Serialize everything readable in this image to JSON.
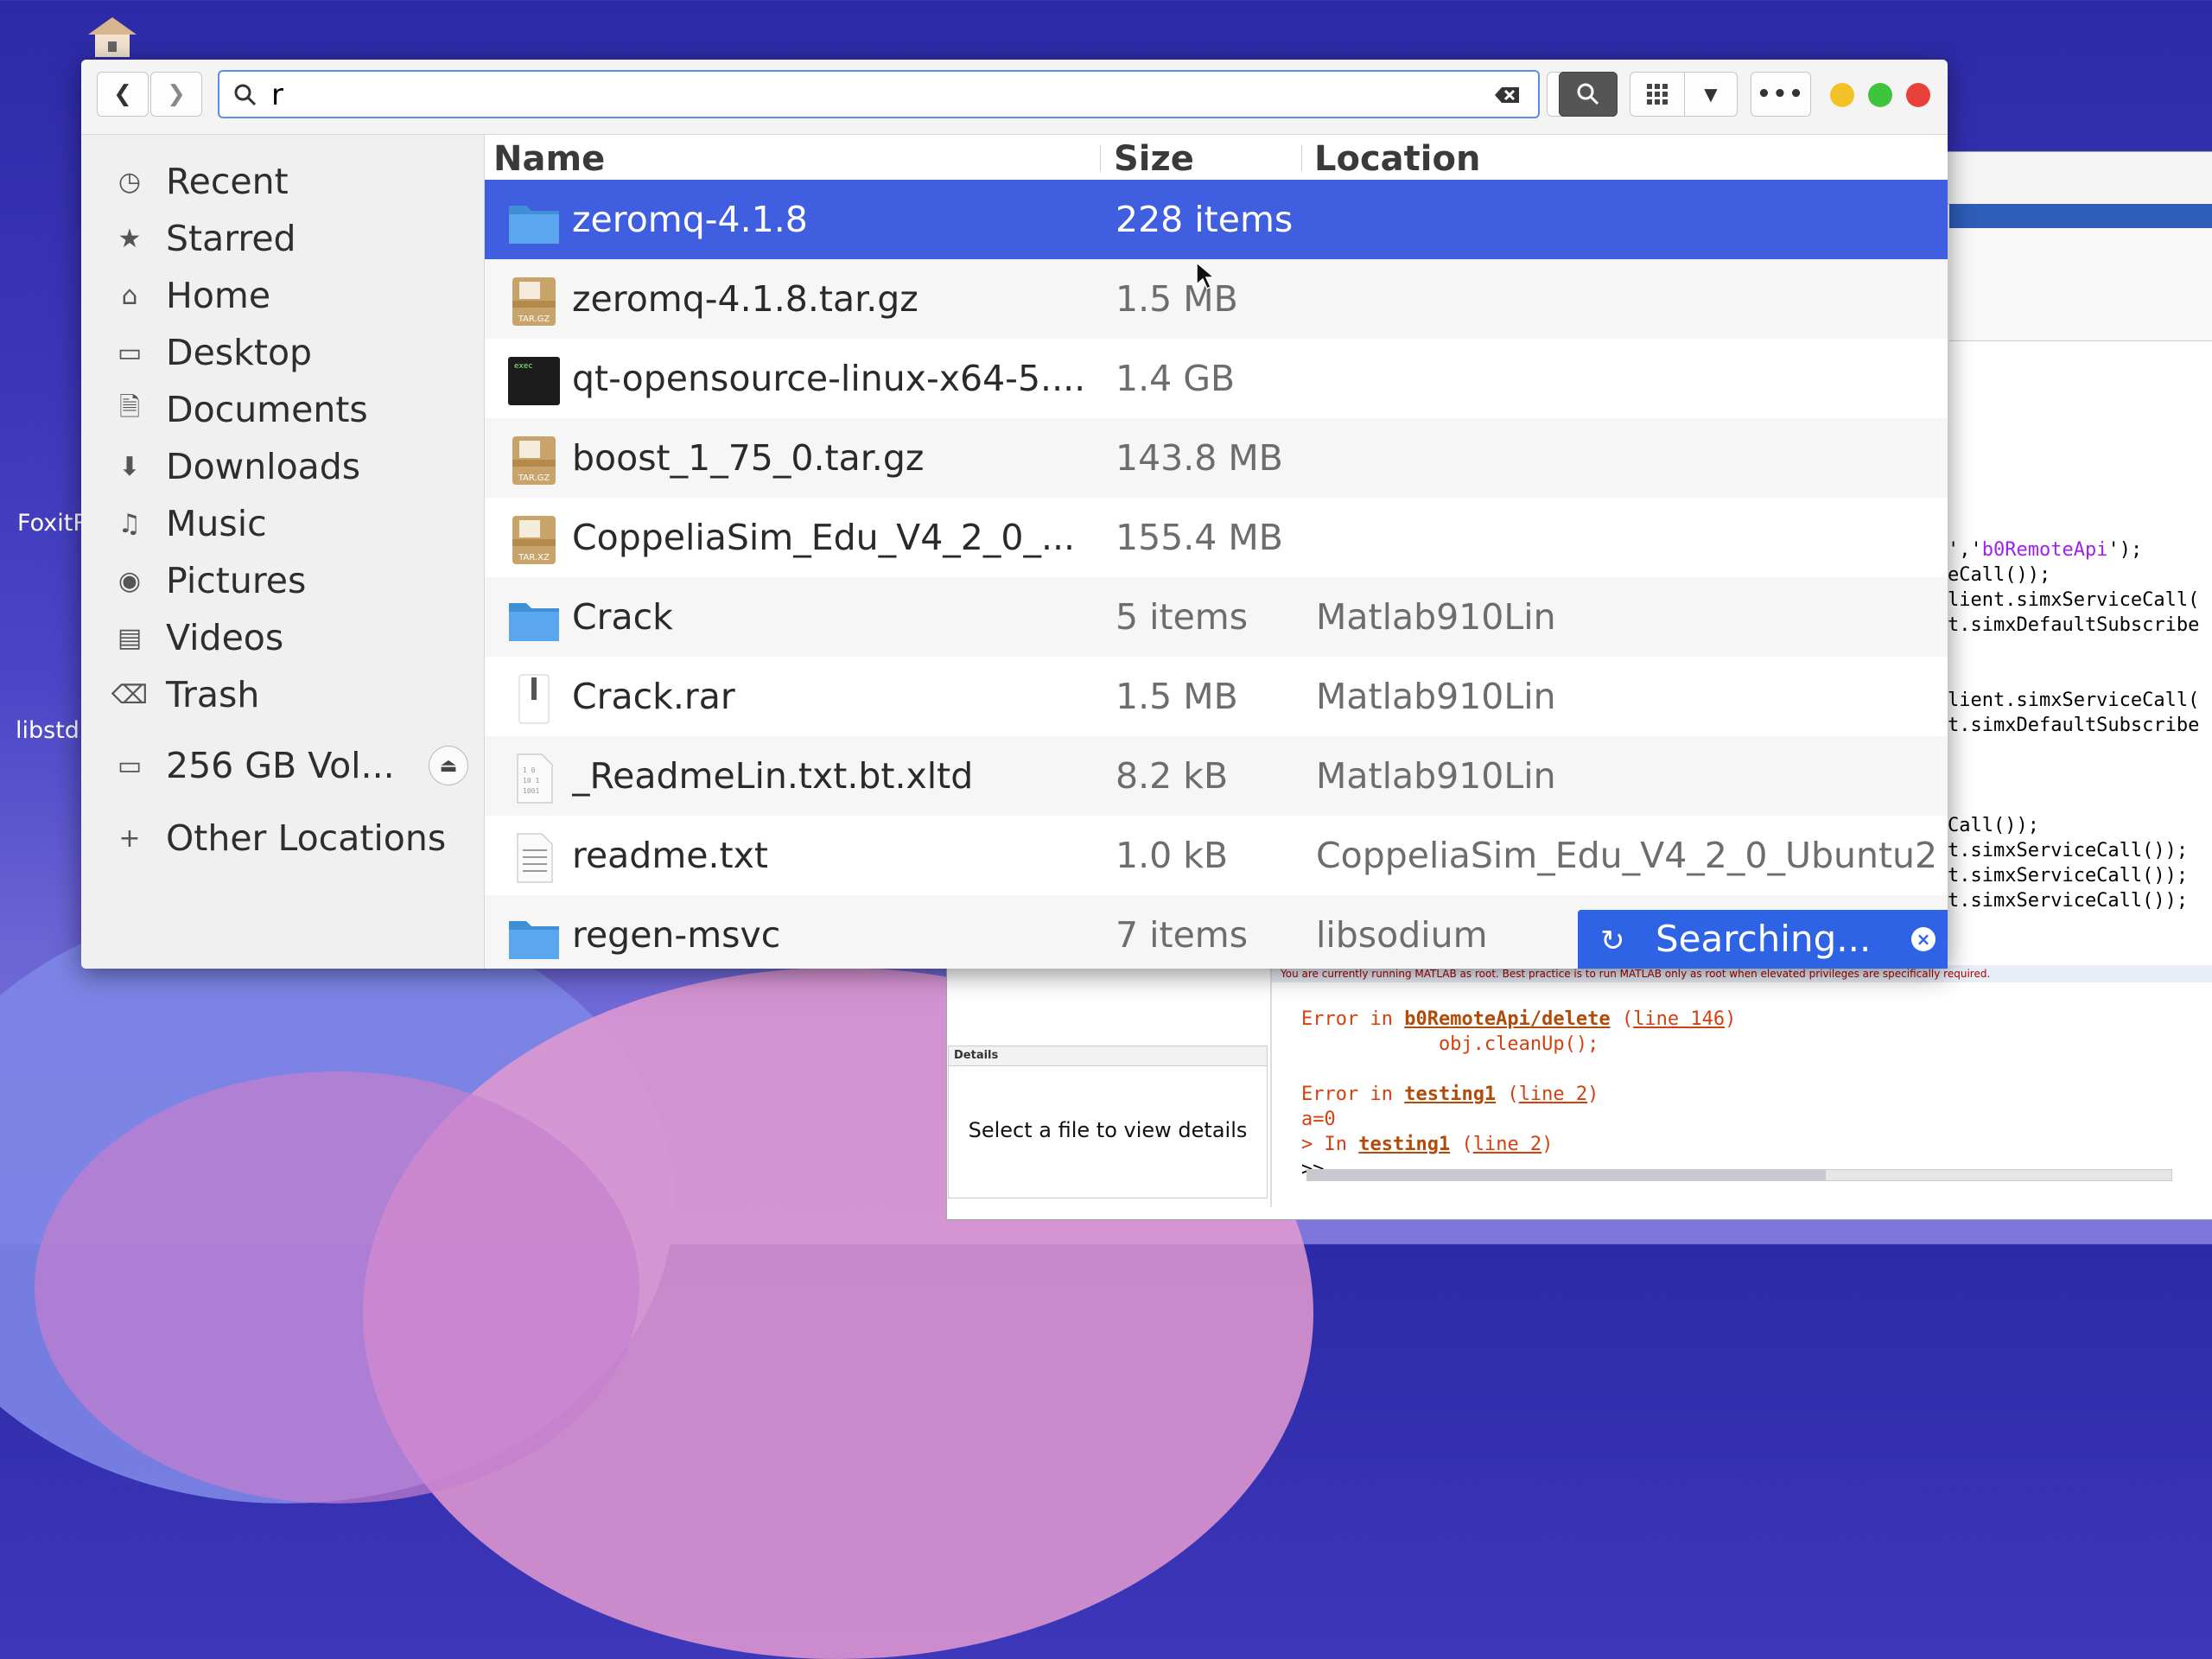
{
  "desktop": {
    "icons": [
      {
        "label": "FoxitR..."
      },
      {
        "label": "libstd..."
      }
    ]
  },
  "toolbar": {
    "search_value": "r",
    "search_placeholder": ""
  },
  "sidebar": {
    "items": [
      {
        "label": "Recent",
        "icon": "clock-icon"
      },
      {
        "label": "Starred",
        "icon": "star-icon"
      },
      {
        "label": "Home",
        "icon": "home-icon"
      },
      {
        "label": "Desktop",
        "icon": "desktop-icon"
      },
      {
        "label": "Documents",
        "icon": "documents-icon"
      },
      {
        "label": "Downloads",
        "icon": "download-icon"
      },
      {
        "label": "Music",
        "icon": "music-icon"
      },
      {
        "label": "Pictures",
        "icon": "camera-icon"
      },
      {
        "label": "Videos",
        "icon": "film-icon"
      },
      {
        "label": "Trash",
        "icon": "trash-icon"
      },
      {
        "label": "256 GB Vol...",
        "icon": "drive-icon"
      },
      {
        "label": "Other Locations",
        "icon": "plus-icon"
      }
    ]
  },
  "list": {
    "headers": {
      "name": "Name",
      "size": "Size",
      "location": "Location"
    },
    "rows": [
      {
        "name": "zeromq-4.1.8",
        "size": "228 items",
        "location": "",
        "type": "folder"
      },
      {
        "name": "zeromq-4.1.8.tar.gz",
        "size": "1.5 MB",
        "location": "",
        "type": "archive-targz",
        "badge": "TAR.GZ"
      },
      {
        "name": "qt-opensource-linux-x64-5....",
        "size": "1.4 GB",
        "location": "",
        "type": "executable",
        "badge": "exec"
      },
      {
        "name": "boost_1_75_0.tar.gz",
        "size": "143.8 MB",
        "location": "",
        "type": "archive-targz",
        "badge": "TAR.GZ"
      },
      {
        "name": "CoppeliaSim_Edu_V4_2_0_...",
        "size": "155.4 MB",
        "location": "",
        "type": "archive-tarxz",
        "badge": "TAR.XZ"
      },
      {
        "name": "Crack",
        "size": "5 items",
        "location": "Matlab910Lin",
        "type": "folder"
      },
      {
        "name": "Crack.rar",
        "size": "1.5 MB",
        "location": "Matlab910Lin",
        "type": "archive-rar"
      },
      {
        "name": "_ReadmeLin.txt.bt.xltd",
        "size": "8.2 kB",
        "location": "Matlab910Lin",
        "type": "binary"
      },
      {
        "name": "readme.txt",
        "size": "1.0 kB",
        "location": "CoppeliaSim_Edu_V4_2_0_Ubuntu2",
        "type": "text"
      },
      {
        "name": "regen-msvc",
        "size": "7 items",
        "location": "libsodium",
        "type": "folder"
      }
    ]
  },
  "toast": {
    "label": "Searching..."
  },
  "matlab": {
    "code": [
      {
        "pre": "','",
        "str": "b0RemoteApi",
        "post": "');"
      },
      {
        "pre": "eCall());",
        "str": "",
        "post": ""
      },
      {
        "pre": "lient.simxServiceCall(",
        "str": "",
        "post": ""
      },
      {
        "pre": "t.simxDefaultSubscribe",
        "str": "",
        "post": ""
      },
      {
        "pre": "",
        "str": "",
        "post": ""
      },
      {
        "pre": "",
        "str": "",
        "post": ""
      },
      {
        "pre": "lient.simxServiceCall(",
        "str": "",
        "post": ""
      },
      {
        "pre": "t.simxDefaultSubscribe",
        "str": "",
        "post": ""
      },
      {
        "pre": "",
        "str": "",
        "post": ""
      },
      {
        "pre": "",
        "str": "",
        "post": ""
      },
      {
        "pre": "",
        "str": "",
        "post": ""
      },
      {
        "pre": "Call());",
        "str": "",
        "post": ""
      },
      {
        "pre": "t.simxServiceCall());",
        "str": "",
        "post": ""
      },
      {
        "pre": "t.simxServiceCall());",
        "str": "",
        "post": ""
      },
      {
        "pre": "t.simxServiceCall());",
        "str": "",
        "post": ""
      }
    ],
    "warning": "You are currently running MATLAB as root. Best practice is to run MATLAB only as root when elevated privileges are specifically required.",
    "details_title": "Details",
    "details_msg": "Select a file to view details",
    "cmd": {
      "l1a": "Error in ",
      "l1b": "b0RemoteApi/delete",
      "l1c": " (",
      "l1d": "line 146",
      "l1e": ")",
      "l2": "            obj.cleanUp();",
      "l4a": "Error in ",
      "l4b": "testing1",
      "l4c": " (",
      "l4d": "line 2",
      "l4e": ")",
      "l5": "a=0",
      "l6a": "> In ",
      "l6b": "testing1",
      "l6c": " (",
      "l6d": "line 2",
      "l6e": ")",
      "prompt": ">>"
    }
  }
}
